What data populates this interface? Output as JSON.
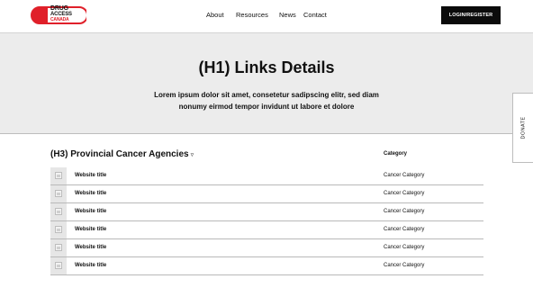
{
  "brand": {
    "line1": "DRUG",
    "line2": "ACCESS",
    "line3": "CANADA",
    "colors": {
      "primary": "#e0202a",
      "dark": "#0b0b0b"
    }
  },
  "nav": {
    "items": [
      "About",
      "Resources",
      "News",
      "Contact"
    ]
  },
  "header": {
    "login_label": "LOGIN/REGISTER"
  },
  "hero": {
    "title": "(H1) Links Details",
    "body": "Lorem ipsum dolor sit amet, consetetur sadipscing elitr, sed diam nonumy eirmod tempor invidunt ut labore et dolore"
  },
  "donate": {
    "label": "DONATE"
  },
  "section": {
    "title": "(H3) Provincial Cancer Agencies",
    "dropdown_icon": "triangle-down-icon",
    "column_header": "Category",
    "rows": [
      {
        "title": "Website title",
        "category": "Cancer Category",
        "icon": "image-placeholder-icon"
      },
      {
        "title": "Website title",
        "category": "Cancer Category",
        "icon": "image-placeholder-icon"
      },
      {
        "title": "Website title",
        "category": "Cancer Category",
        "icon": "image-placeholder-icon"
      },
      {
        "title": "Website title",
        "category": "Cancer Category",
        "icon": "image-placeholder-icon"
      },
      {
        "title": "Website title",
        "category": "Cancer Category",
        "icon": "image-placeholder-icon"
      },
      {
        "title": "Website title",
        "category": "Cancer Category",
        "icon": "image-placeholder-icon"
      }
    ]
  }
}
